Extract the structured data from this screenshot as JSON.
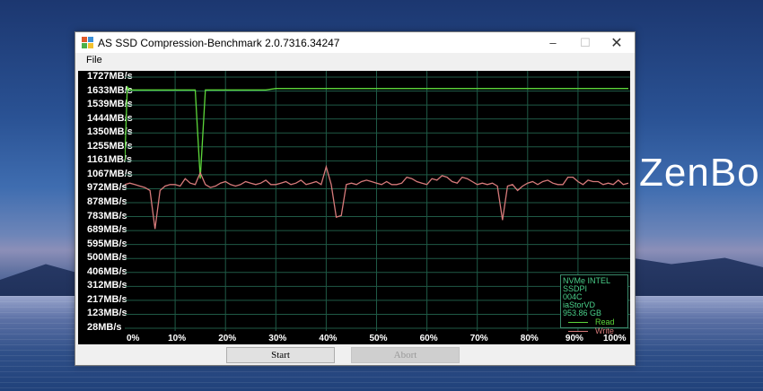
{
  "desktop": {
    "brand_main": "ZenBo",
    "brand_accent": "o"
  },
  "window": {
    "title": "AS SSD Compression-Benchmark 2.0.7316.34247",
    "controls": {
      "minimize": "–",
      "maximize": "☐",
      "close": "✕"
    }
  },
  "menu": {
    "file": "File"
  },
  "chart_data": {
    "type": "line",
    "title": "",
    "xlabel": "",
    "ylabel": "",
    "y_ticks": [
      "1727MB/s",
      "1633MB/s",
      "1539MB/s",
      "1444MB/s",
      "1350MB/s",
      "1255MB/s",
      "1161MB/s",
      "1067MB/s",
      "972MB/s",
      "878MB/s",
      "783MB/s",
      "689MB/s",
      "595MB/s",
      "500MB/s",
      "406MB/s",
      "312MB/s",
      "217MB/s",
      "123MB/s",
      "28MB/s"
    ],
    "x_ticks": [
      "0%",
      "10%",
      "20%",
      "30%",
      "40%",
      "50%",
      "60%",
      "70%",
      "80%",
      "90%",
      "100%"
    ],
    "xlim": [
      0,
      100
    ],
    "ylim": [
      28,
      1727
    ],
    "grid": true,
    "legend_position": "bottom-right",
    "series": [
      {
        "name": "Read",
        "color": "#5cd63a",
        "x": [
          0,
          0.5,
          1,
          2,
          4,
          6,
          8,
          10,
          12,
          14,
          15,
          16,
          18,
          20,
          22,
          24,
          26,
          28,
          30,
          32,
          34,
          36,
          38,
          40,
          42,
          44,
          46,
          48,
          50,
          52,
          54,
          56,
          58,
          60,
          62,
          64,
          66,
          68,
          70,
          72,
          74,
          76,
          78,
          80,
          82,
          84,
          86,
          88,
          90,
          92,
          94,
          96,
          98,
          100
        ],
        "y": [
          1160,
          1660,
          1640,
          1640,
          1640,
          1640,
          1640,
          1640,
          1640,
          1640,
          1040,
          1640,
          1640,
          1640,
          1640,
          1640,
          1640,
          1640,
          1650,
          1650,
          1650,
          1650,
          1650,
          1650,
          1650,
          1650,
          1650,
          1650,
          1650,
          1650,
          1650,
          1650,
          1650,
          1650,
          1650,
          1650,
          1650,
          1650,
          1650,
          1650,
          1650,
          1650,
          1650,
          1650,
          1650,
          1650,
          1650,
          1650,
          1650,
          1650,
          1650,
          1650,
          1650,
          1650
        ]
      },
      {
        "name": "Write",
        "color": "#d67a7a",
        "x": [
          0,
          1,
          2,
          3,
          4,
          5,
          6,
          7,
          8,
          9,
          10,
          11,
          12,
          13,
          14,
          15,
          16,
          17,
          18,
          19,
          20,
          21,
          22,
          23,
          24,
          25,
          26,
          27,
          28,
          29,
          30,
          31,
          32,
          33,
          34,
          35,
          36,
          37,
          38,
          39,
          40,
          41,
          42,
          43,
          44,
          45,
          46,
          47,
          48,
          49,
          50,
          51,
          52,
          53,
          54,
          55,
          56,
          57,
          58,
          59,
          60,
          61,
          62,
          63,
          64,
          65,
          66,
          67,
          68,
          69,
          70,
          71,
          72,
          73,
          74,
          75,
          76,
          77,
          78,
          79,
          80,
          81,
          82,
          83,
          84,
          85,
          86,
          87,
          88,
          89,
          90,
          91,
          92,
          93,
          94,
          95,
          96,
          97,
          98,
          99,
          100
        ],
        "y": [
          1000,
          1010,
          1000,
          990,
          980,
          960,
          700,
          960,
          990,
          1000,
          1000,
          990,
          1040,
          1010,
          1000,
          1080,
          1000,
          980,
          990,
          1010,
          1020,
          1000,
          990,
          1000,
          1020,
          1010,
          1000,
          1010,
          1030,
          1000,
          1000,
          1010,
          1020,
          1000,
          1010,
          1030,
          1000,
          1010,
          1020,
          1000,
          1120,
          1000,
          780,
          790,
          1000,
          1010,
          1000,
          1020,
          1030,
          1020,
          1010,
          1000,
          1020,
          1000,
          1000,
          1010,
          1050,
          1040,
          1020,
          1010,
          1000,
          1040,
          1030,
          1060,
          1050,
          1020,
          1010,
          1050,
          1040,
          1020,
          1000,
          1010,
          1000,
          1010,
          990,
          760,
          990,
          1000,
          960,
          990,
          1010,
          1020,
          1000,
          1020,
          1030,
          1010,
          1000,
          1000,
          1050,
          1050,
          1020,
          1000,
          1030,
          1020,
          1020,
          1000,
          1010,
          1000,
          1030,
          1000,
          1010
        ]
      }
    ]
  },
  "legend": {
    "device_line1": "NVMe INTEL SSDPI",
    "device_line2": "004C",
    "driver": "iaStorVD",
    "capacity": "953.86 GB",
    "read_label": "Read",
    "write_label": "Write"
  },
  "buttons": {
    "start": "Start",
    "abort": "Abort"
  }
}
